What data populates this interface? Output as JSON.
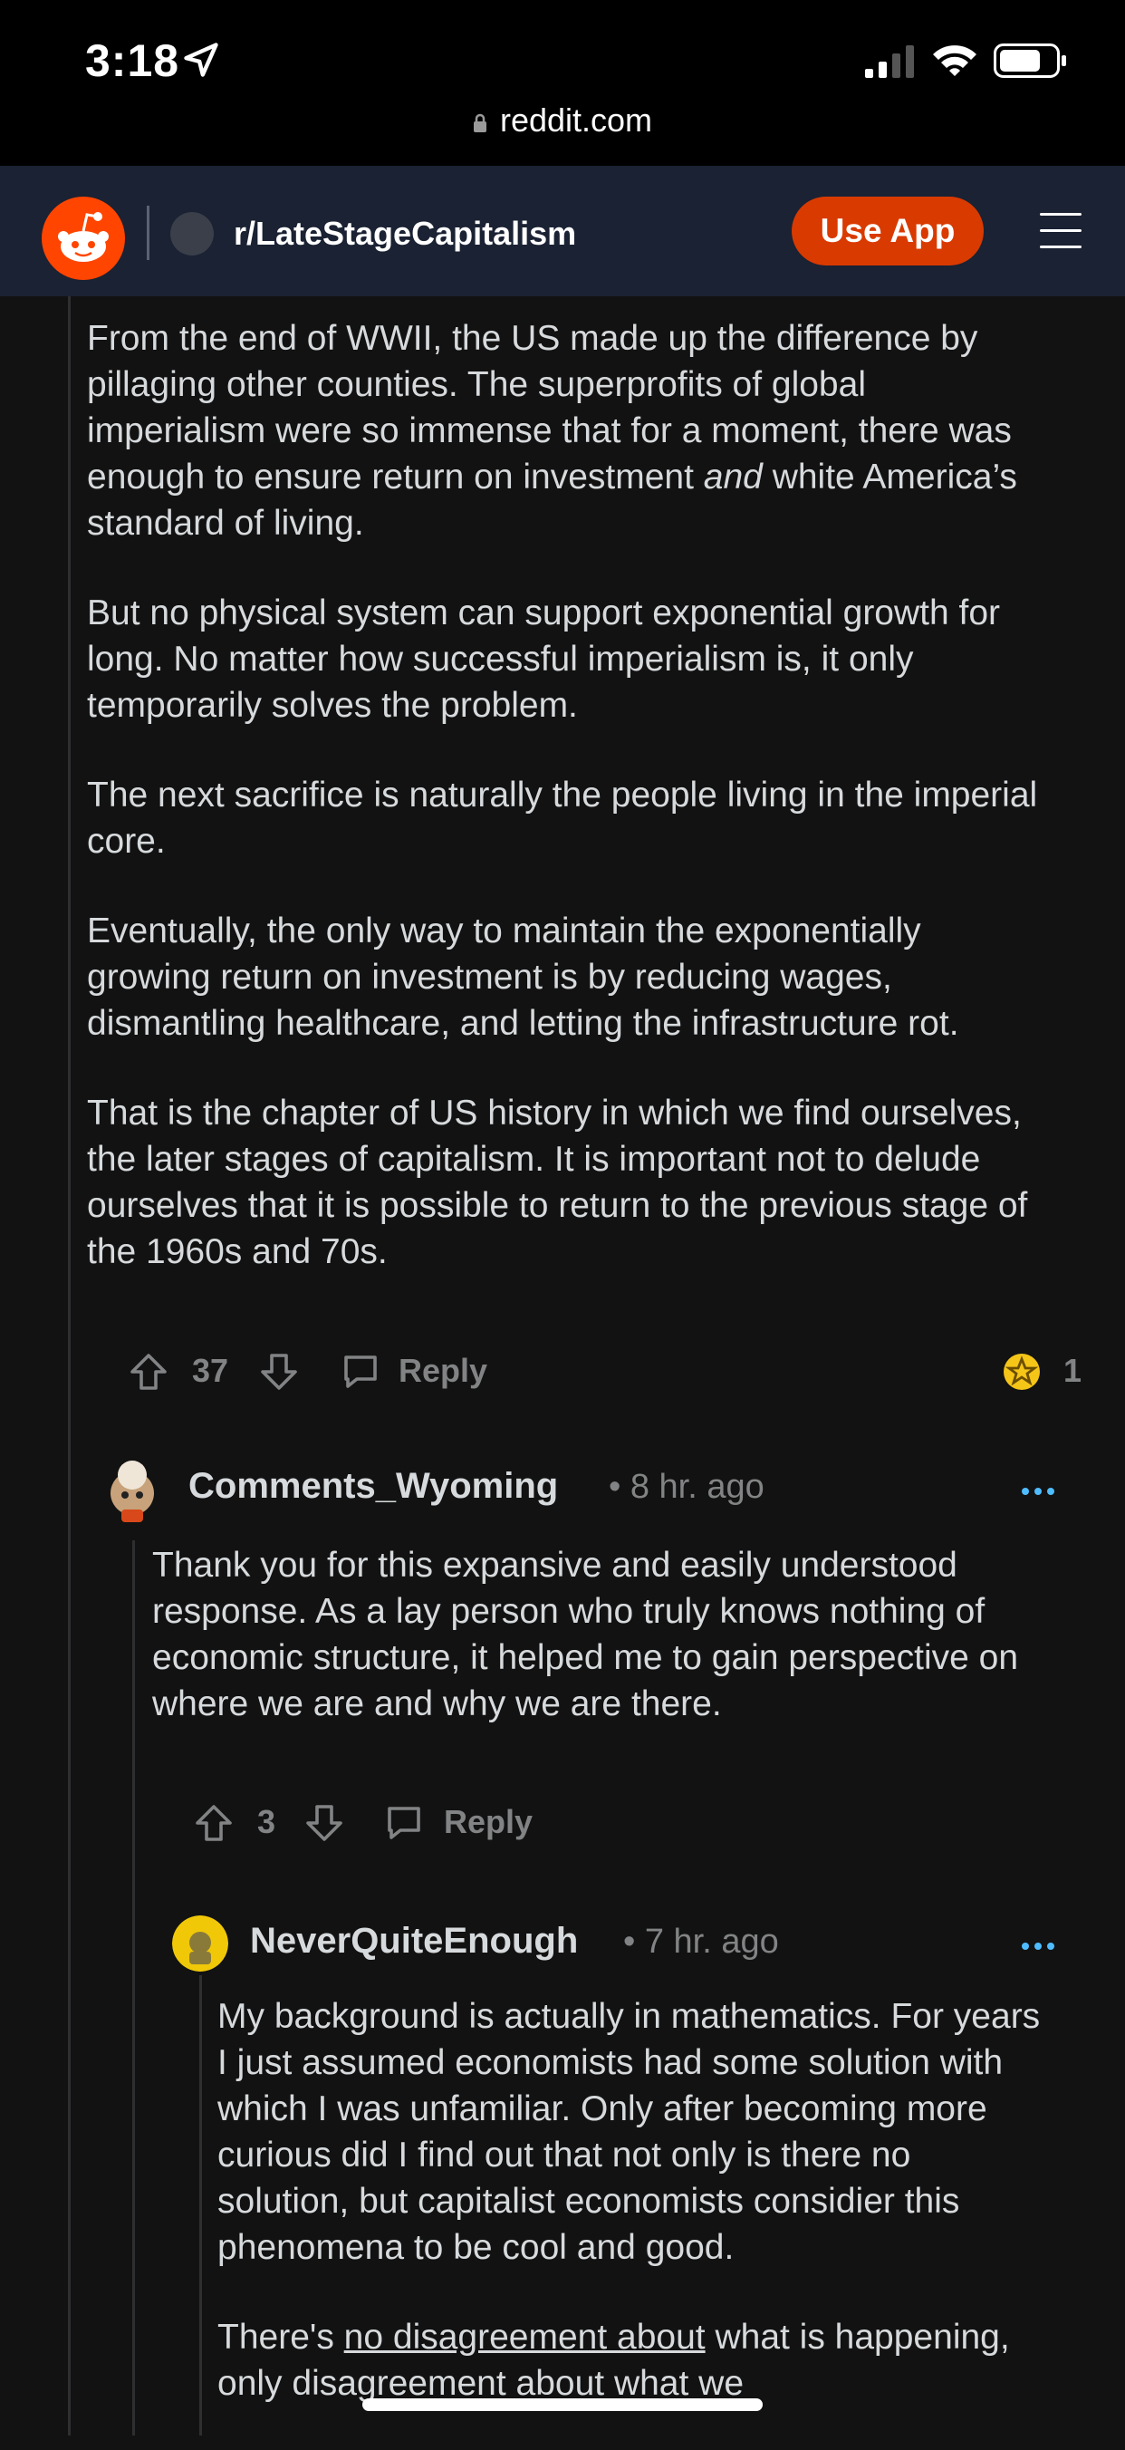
{
  "status_bar": {
    "time": "3:18",
    "url": "reddit.com"
  },
  "header": {
    "subreddit": "r/LateStageCapitalism",
    "use_app": "Use App"
  },
  "colors": {
    "accent": "#d93a00",
    "link": "#4fbcff",
    "award": "#f5c518"
  },
  "parent_comment": {
    "paragraphs": [
      {
        "before": "From the end of WWII, the US made up the difference by pillaging other counties. The superprofits of global imperialism were so immense that for a moment, there was enough to ensure return on investment ",
        "emph": "and",
        "after": " white America’s standard of living."
      },
      {
        "before": "But no physical system can support exponential growth for long. No matter how successful imperialism is, it only temporarily solves the problem.",
        "emph": "",
        "after": ""
      },
      {
        "before": "The next sacrifice is naturally the people living in the imperial core.",
        "emph": "",
        "after": ""
      },
      {
        "before": "Eventually, the only way to maintain the exponentially growing return on investment is by reducing wages, dismantling healthcare, and letting the infrastructure rot.",
        "emph": "",
        "after": ""
      },
      {
        "before": "That is the chapter of US history in which we find ourselves, the later stages of capitalism. It is important not to delude ourselves that it is possible to return to the previous stage of the 1960s and 70s.",
        "emph": "",
        "after": ""
      }
    ],
    "votes": "37",
    "reply": "Reply",
    "awards": "1"
  },
  "comment_2": {
    "username": "Comments_Wyoming",
    "time": "• 8 hr. ago",
    "text": "Thank you for this expansive and easily understood response. As a lay person who truly knows nothing of economic structure, it helped me to gain perspective on where we are and why we are there.",
    "votes": "3",
    "reply": "Reply"
  },
  "comment_3": {
    "username": "NeverQuiteEnough",
    "time": "• 7 hr. ago",
    "text1": "My background is actually in mathematics. For years I just assumed economists had some solution with which I was unfamiliar. Only after becoming more curious did I find out that not only is there no solution, but capitalist economists considier this phenomena to be cool and good.",
    "text2_before": "There's ",
    "text2_link": "no disagreement about",
    "text2_after": " what is happening, only disagreement about what we"
  }
}
